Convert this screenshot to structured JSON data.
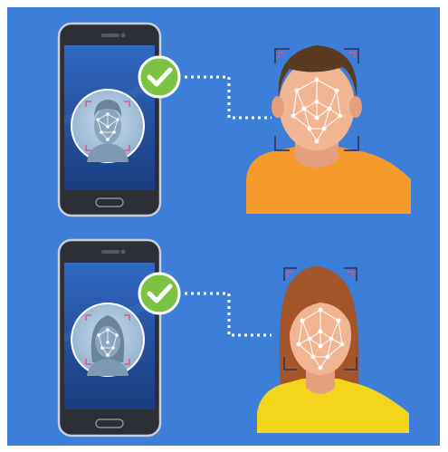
{
  "scene": {
    "background": "#3d7fd8",
    "outer_background": "#ffffff",
    "rows": [
      {
        "id": "male",
        "phone_icon": "smartphone-icon",
        "face_on_screen": "male-face-scan-icon",
        "status_icon": "checkmark-circle-icon",
        "connector": "dotted-connector",
        "person": "male-person-face-mesh",
        "shirt_color": "#f59a2b",
        "hair_color": "#5b3a22"
      },
      {
        "id": "female",
        "phone_icon": "smartphone-icon",
        "face_on_screen": "female-face-scan-icon",
        "status_icon": "checkmark-circle-icon",
        "connector": "dotted-connector",
        "person": "female-person-face-mesh",
        "shirt_color": "#f4d51e",
        "hair_color": "#a5552a"
      }
    ],
    "colors": {
      "skin": "#f2b593",
      "skin_shade": "#e4a07e",
      "phone_body": "#2c2f36",
      "phone_screen_top": "#2d62b7",
      "phone_screen_bottom": "#1c3f84",
      "check_green": "#7cc243",
      "mesh_white": "#ffffff",
      "bracket_dark": "#3a3a5a"
    }
  }
}
